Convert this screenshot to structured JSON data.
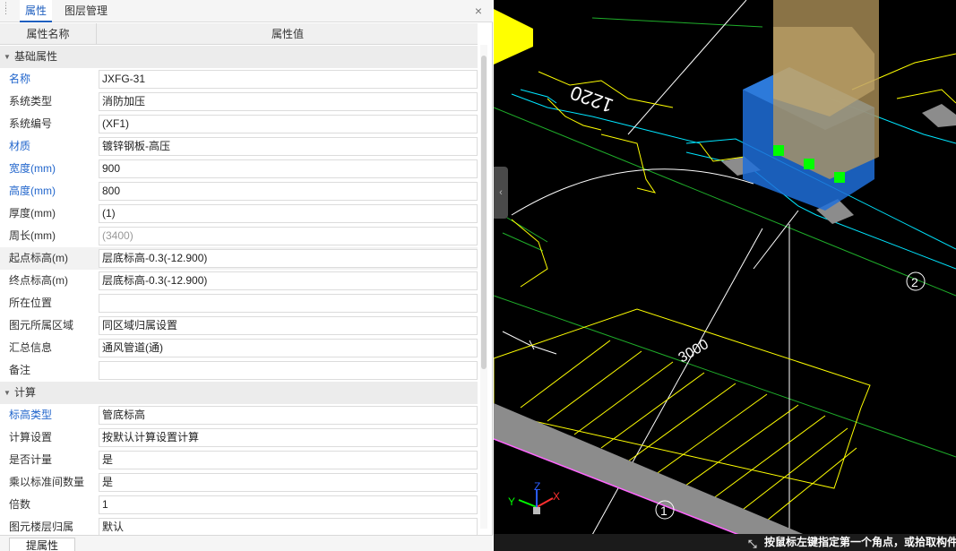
{
  "tabs": [
    {
      "label": "属性"
    },
    {
      "label": "图层管理"
    }
  ],
  "close_icon": "×",
  "grid": {
    "header_name": "属性名称",
    "header_value": "属性值"
  },
  "sections": [
    {
      "title": "基础属性"
    },
    {
      "title": "计算"
    }
  ],
  "rows_basic": [
    {
      "name": "名称",
      "value": "JXFG-31"
    },
    {
      "name": "系统类型",
      "value": "消防加压"
    },
    {
      "name": "系统编号",
      "value": "(XF1)"
    },
    {
      "name": "材质",
      "value": "镀锌钢板-高压"
    },
    {
      "name": "宽度(mm)",
      "value": "900"
    },
    {
      "name": "高度(mm)",
      "value": "800"
    },
    {
      "name": "厚度(mm)",
      "value": "(1)"
    },
    {
      "name": "周长(mm)",
      "value": "(3400)"
    },
    {
      "name": "起点标高(m)",
      "value": "层底标高-0.3(-12.900)"
    },
    {
      "name": "终点标高(m)",
      "value": "层底标高-0.3(-12.900)"
    },
    {
      "name": "所在位置",
      "value": ""
    },
    {
      "name": "图元所属区域",
      "value": "同区域归属设置"
    },
    {
      "name": "汇总信息",
      "value": "通风管道(通)"
    },
    {
      "name": "备注",
      "value": ""
    }
  ],
  "rows_calc": [
    {
      "name": "标高类型",
      "value": "管底标高"
    },
    {
      "name": "计算设置",
      "value": "按默认计算设置计算"
    },
    {
      "name": "是否计量",
      "value": "是"
    },
    {
      "name": "乘以标准间数量",
      "value": "是"
    },
    {
      "name": "倍数",
      "value": "1"
    },
    {
      "name": "图元楼层归属",
      "value": "默认"
    }
  ],
  "bottom_tab": "提属性",
  "viewport": {
    "dim_label_1": "3000",
    "dim_label_2": "1220",
    "axis_marker_1": "1",
    "axis_marker_2": "2",
    "axis_x": "X",
    "axis_y": "Y",
    "axis_z": "Z",
    "status_text": "按鼠标左键指定第一个角点，或拾取构件",
    "colors": {
      "background": "#000000",
      "duct_blue": "#1e6fd9",
      "column_tan": "#b89a5e",
      "lines_yellow": "#ffff00",
      "lines_cyan": "#00e5ff",
      "lines_green": "#1fae2a",
      "grip_green": "#00ff00",
      "wall_gray": "#8c8c8c"
    }
  }
}
